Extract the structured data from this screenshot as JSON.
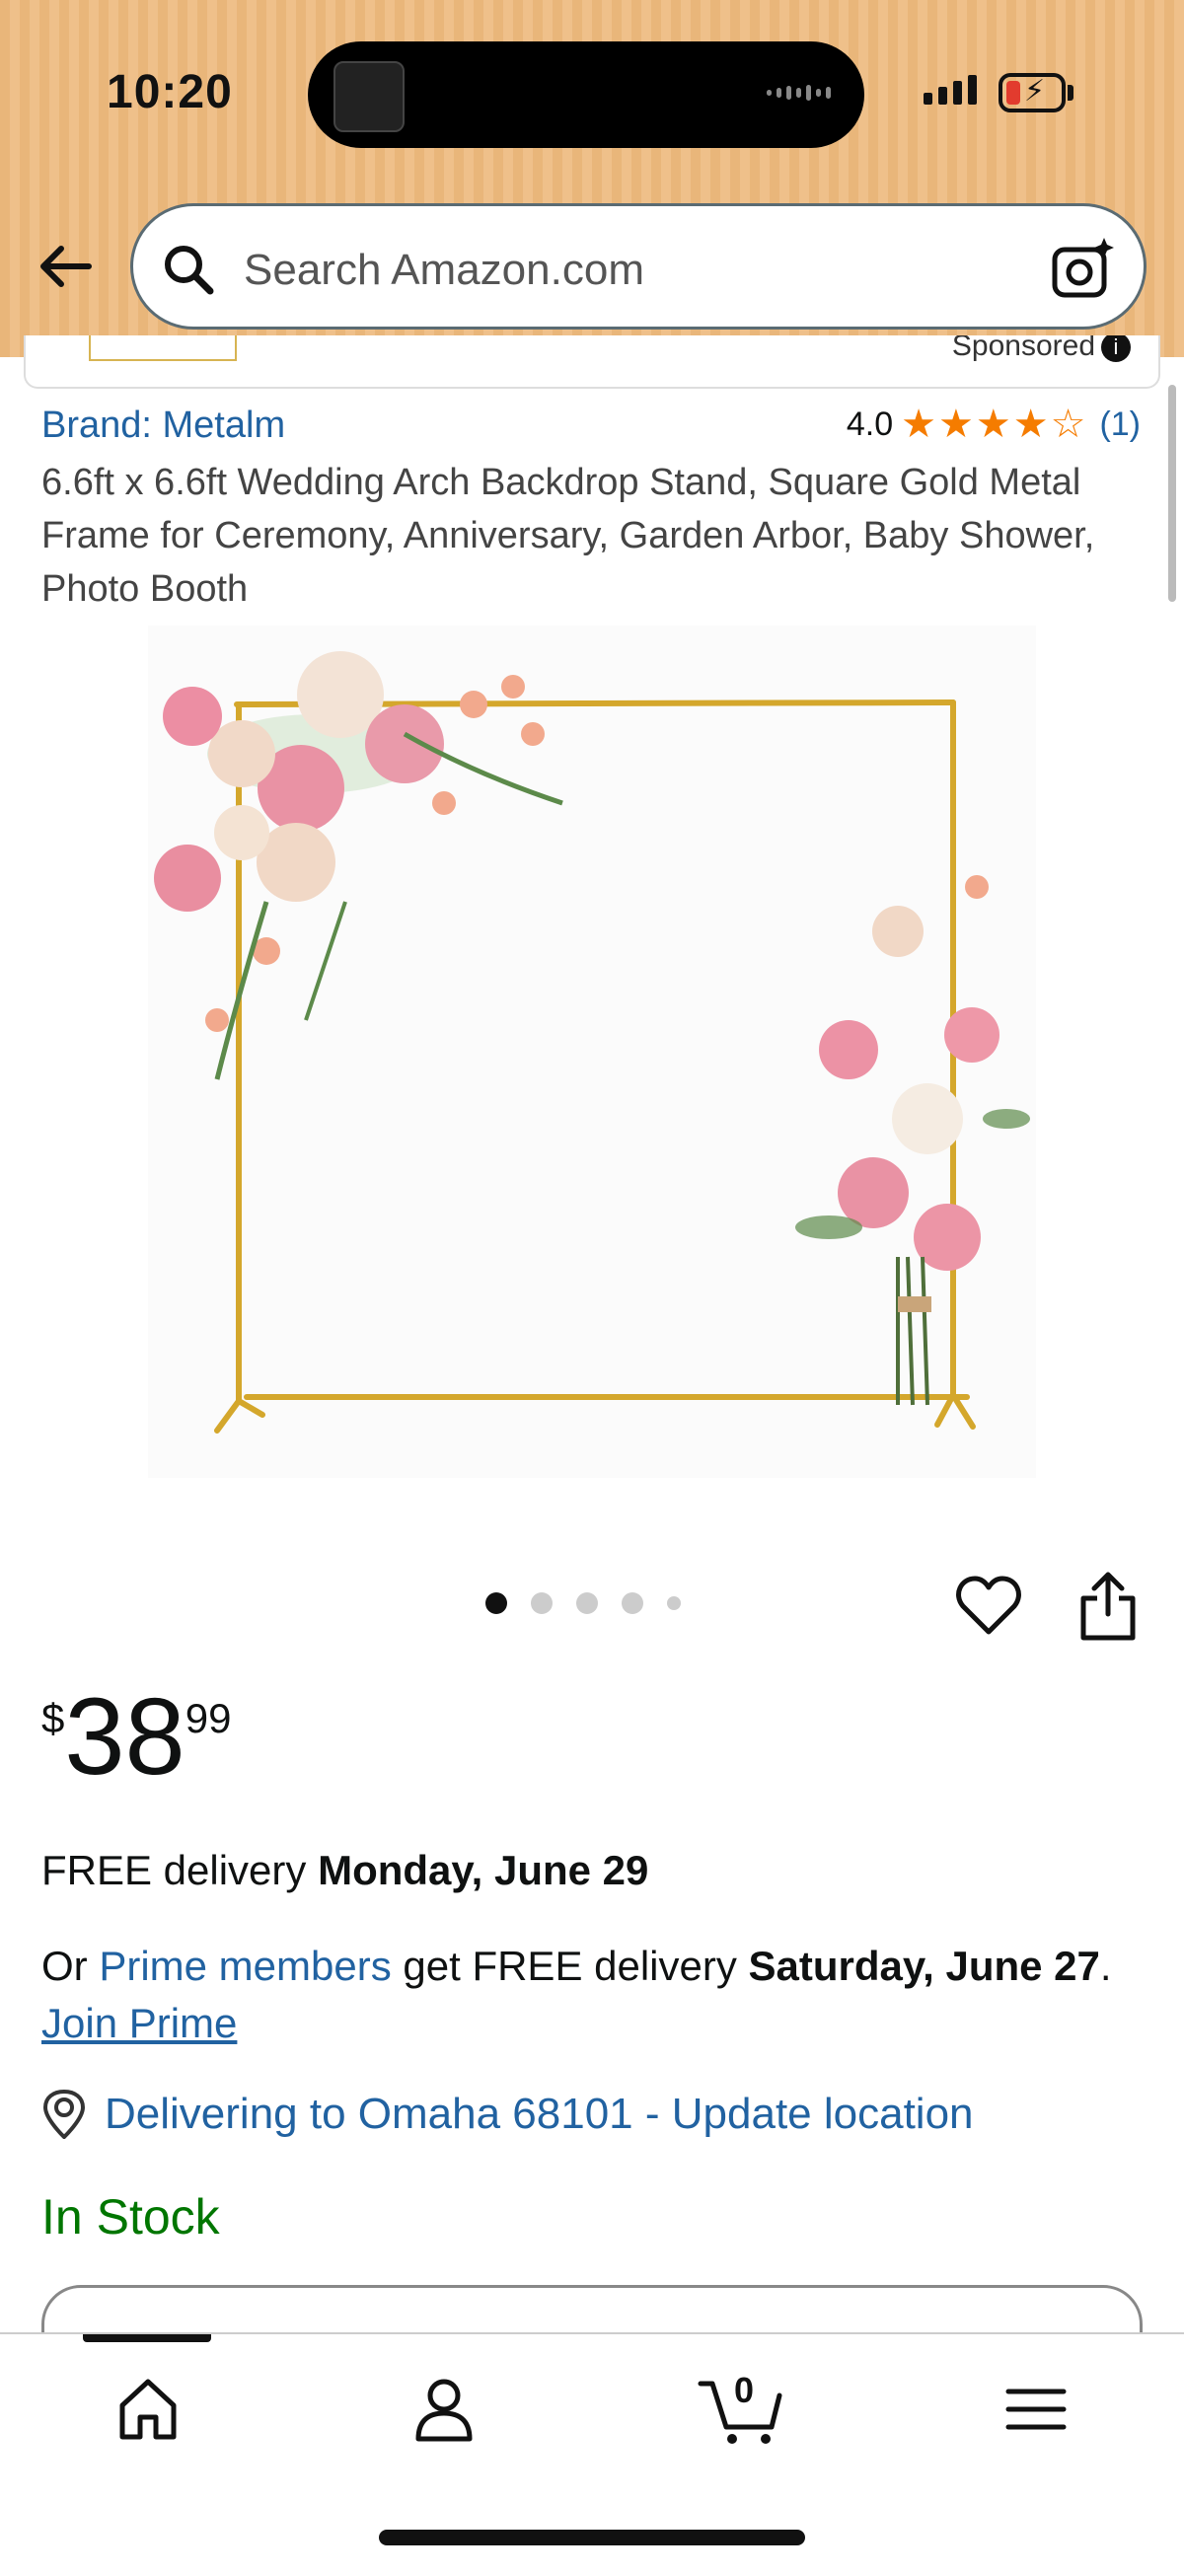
{
  "status_bar": {
    "time": "10:20"
  },
  "search": {
    "placeholder": "Search Amazon.com"
  },
  "sponsored": {
    "label": "Sponsored"
  },
  "product": {
    "brand": "Brand: Metalm",
    "rating": "4.0",
    "stars_filled": 4,
    "stars_total": 5,
    "review_count": "(1)",
    "title": "6.6ft x 6.6ft Wedding Arch Backdrop Stand, Square Gold Metal Frame for Ceremony, Anniversary, Garden Arbor, Baby Shower, Photo Booth"
  },
  "carousel": {
    "image_count": 5,
    "active_index": 0
  },
  "price": {
    "symbol": "$",
    "dollars": "38",
    "cents": "99"
  },
  "delivery": {
    "prefix": "FREE delivery ",
    "date": "Monday, June 29",
    "prime_or": "Or ",
    "prime_members": "Prime members",
    "prime_get": " get FREE delivery ",
    "prime_date": "Saturday, June 27",
    "prime_period": ". ",
    "join_prime": "Join Prime"
  },
  "location": {
    "text": "Delivering to Omaha 68101 - Update location"
  },
  "stock": {
    "status": "In Stock"
  },
  "tabbar": {
    "cart_count": "0",
    "items": [
      "home-icon",
      "account-icon",
      "cart-icon",
      "menu-icon"
    ]
  },
  "colors": {
    "header_bg": "#e9b67a",
    "link": "#2162a1",
    "in_stock": "#007600",
    "star": "#f57c00"
  }
}
